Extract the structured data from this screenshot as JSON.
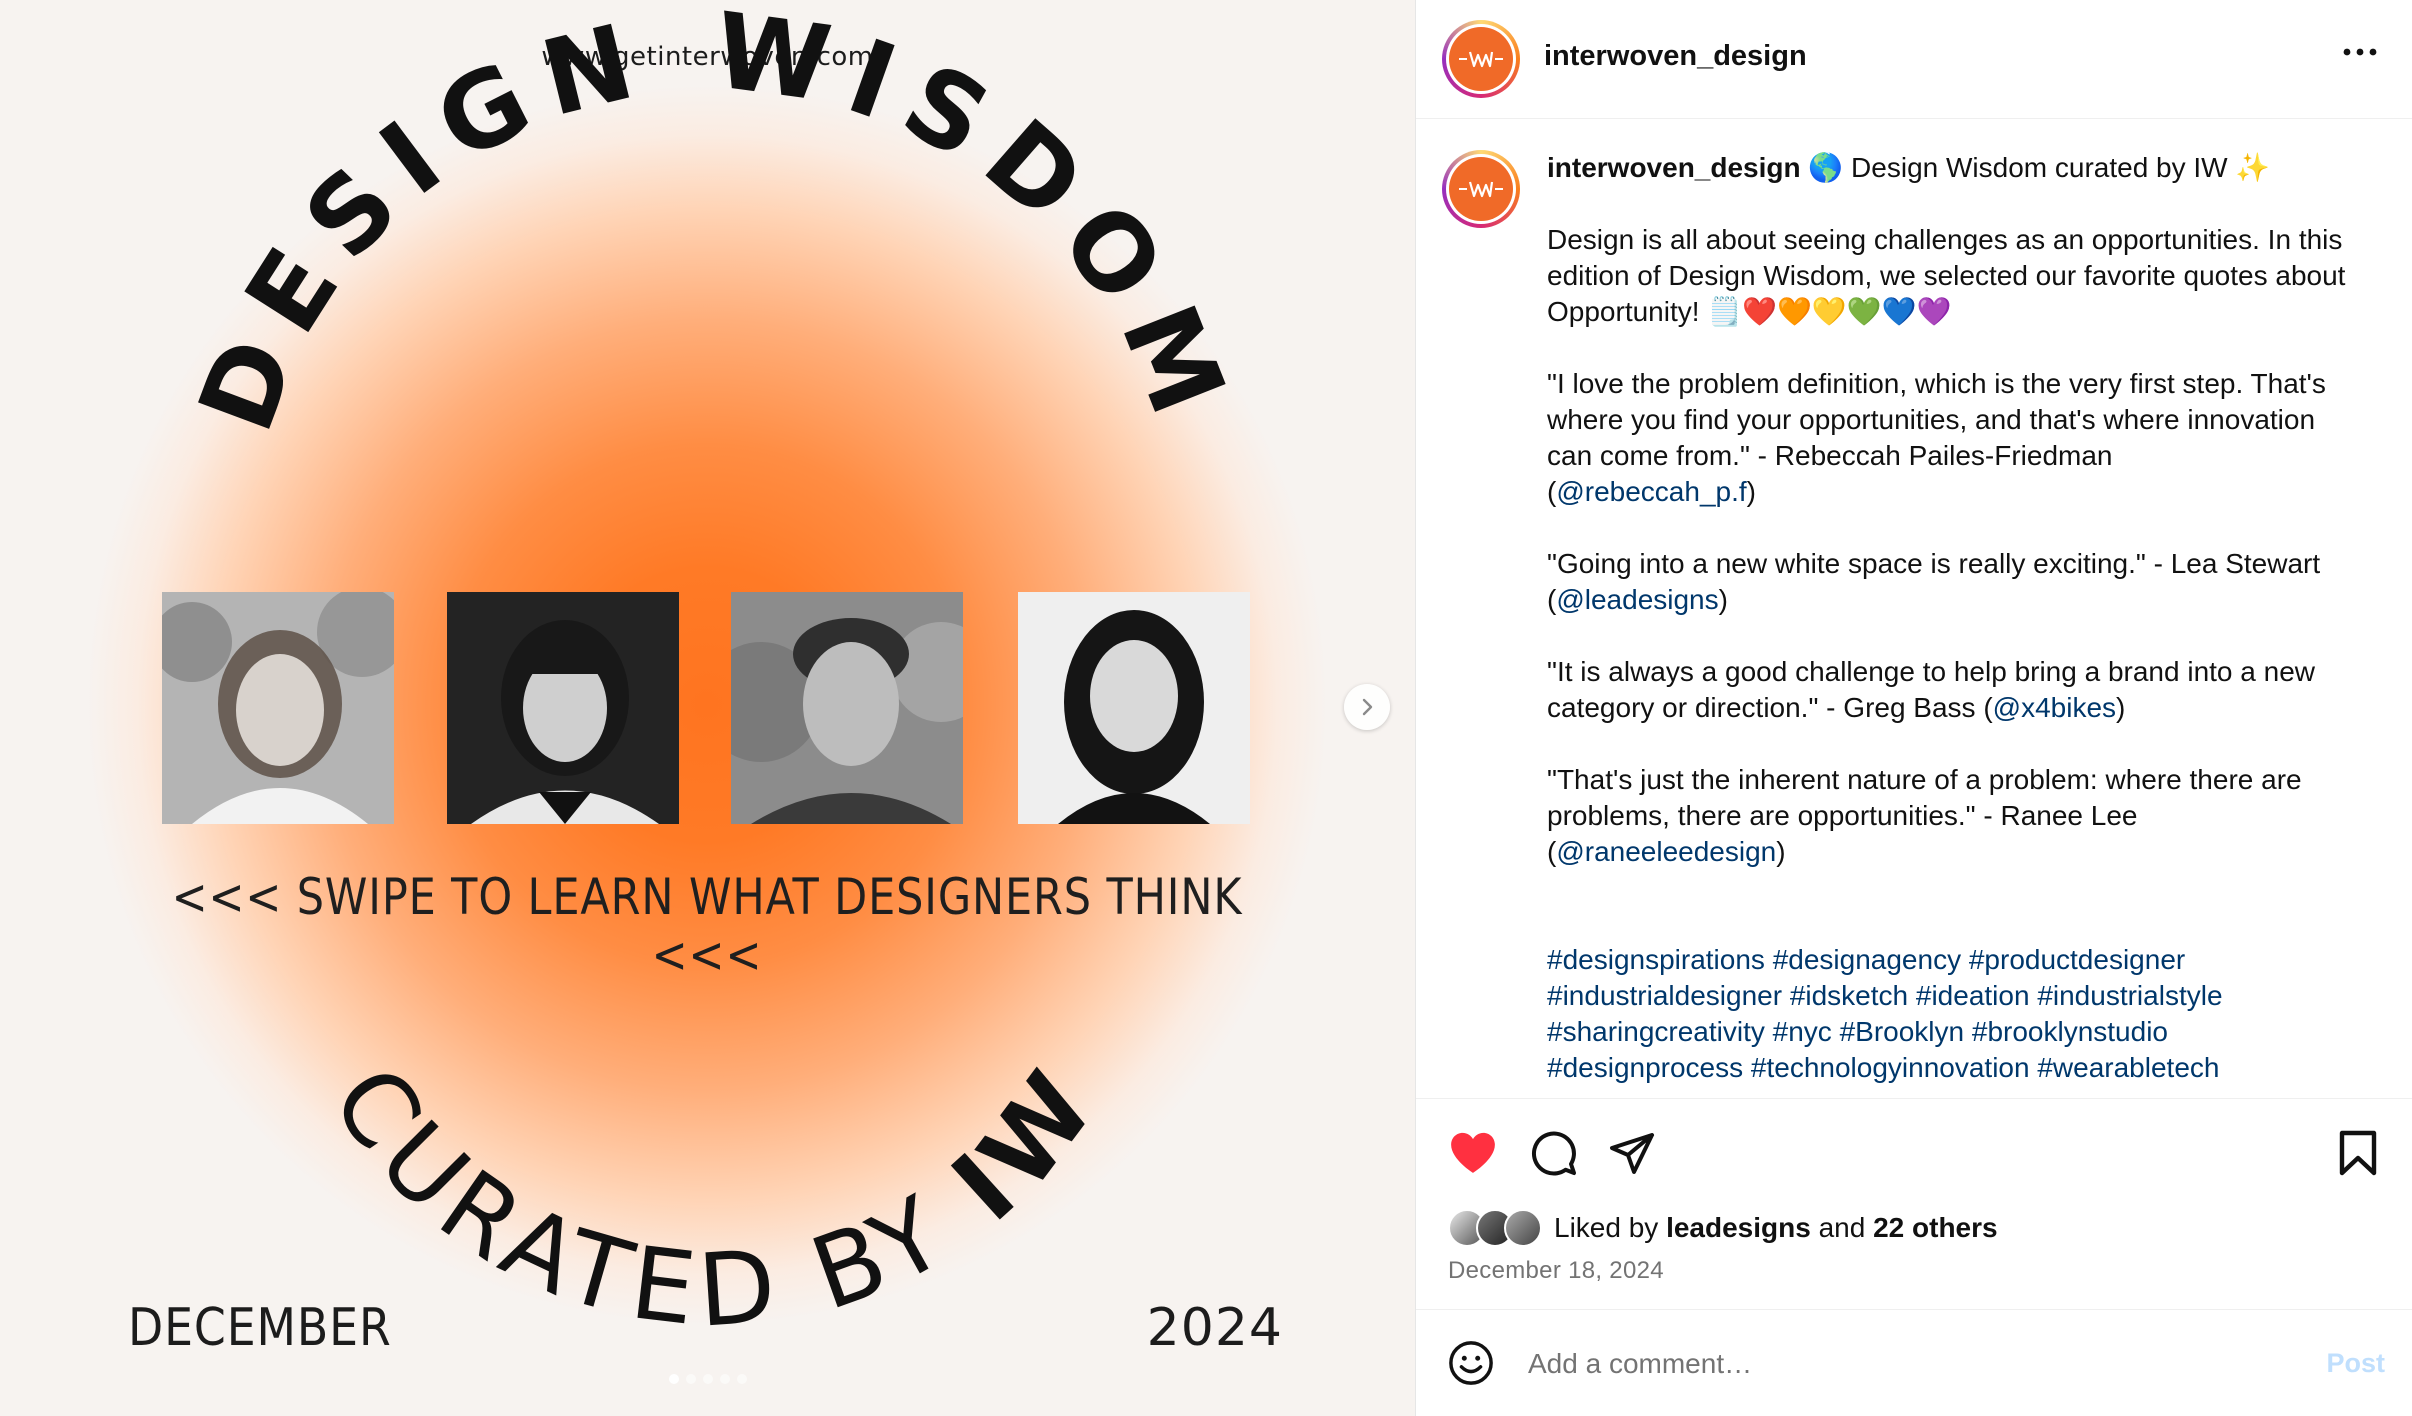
{
  "media": {
    "site_url": "www.getinterwoven.com",
    "arc_title_top": "DESIGN WISDOM",
    "arc_title_bottom_a": "CURATED BY ",
    "arc_title_bottom_b": "IW",
    "swipe_text": "<<< SWIPE TO LEARN WHAT DESIGNERS THINK <<<",
    "month": "DECEMBER",
    "year": "2024",
    "slide_count": 5,
    "active_slide": 1
  },
  "header": {
    "username": "interwoven_design",
    "logo_text": "-IW-"
  },
  "caption": {
    "username": "interwoven_design",
    "intro": "🌎 Design Wisdom curated by IW ✨",
    "para1": "Design is all about seeing challenges as an opportunities. In this edition of Design Wisdom, we selected our favorite quotes about Opportunity! 🗒️❤️🧡💛💚💙💜",
    "quote1": "\"I love the problem definition, which is the very first step. That's where you find your opportunities, and that's where innovation can come from.\" - Rebeccah Pailes-Friedman",
    "quote1_open": "(",
    "quote1_handle": "@rebeccah_p.f",
    "quote1_close": ")",
    "quote2": "\"Going into a new white space is really exciting.\" - Lea Stewart",
    "quote2_open": "(",
    "quote2_handle": "@leadesigns",
    "quote2_close": ")",
    "quote3": "\"It is always a good challenge to help bring a brand into a new category or direction.\" - Greg Bass ",
    "quote3_open": "(",
    "quote3_handle": "@x4bikes",
    "quote3_close": ")",
    "quote4": "\"That's just the inherent nature of a problem: where there are problems, there are opportunities.\" - Ranee Lee",
    "quote4_open": "(",
    "quote4_handle": "@raneeleedesign",
    "quote4_close": ")",
    "hashtags": "#designspirations #designagency #productdesigner #industrialdesigner #idsketch #ideation #industrialstyle #sharingcreativity #nyc #Brooklyn #brooklynstudio #designprocess #technologyinnovation #wearabletech"
  },
  "actions": {
    "liked": true,
    "liked_by_prefix": "Liked by ",
    "liked_by_user": "leadesigns",
    "liked_by_mid": " and ",
    "liked_by_others": "22 others",
    "date": "December 18, 2024"
  },
  "comment": {
    "placeholder": "Add a comment…",
    "post_label": "Post"
  },
  "colors": {
    "accent_orange": "#ff7420",
    "like_red": "#ff3040",
    "link_blue": "#00376b",
    "post_disabled": "#c0dffd"
  }
}
